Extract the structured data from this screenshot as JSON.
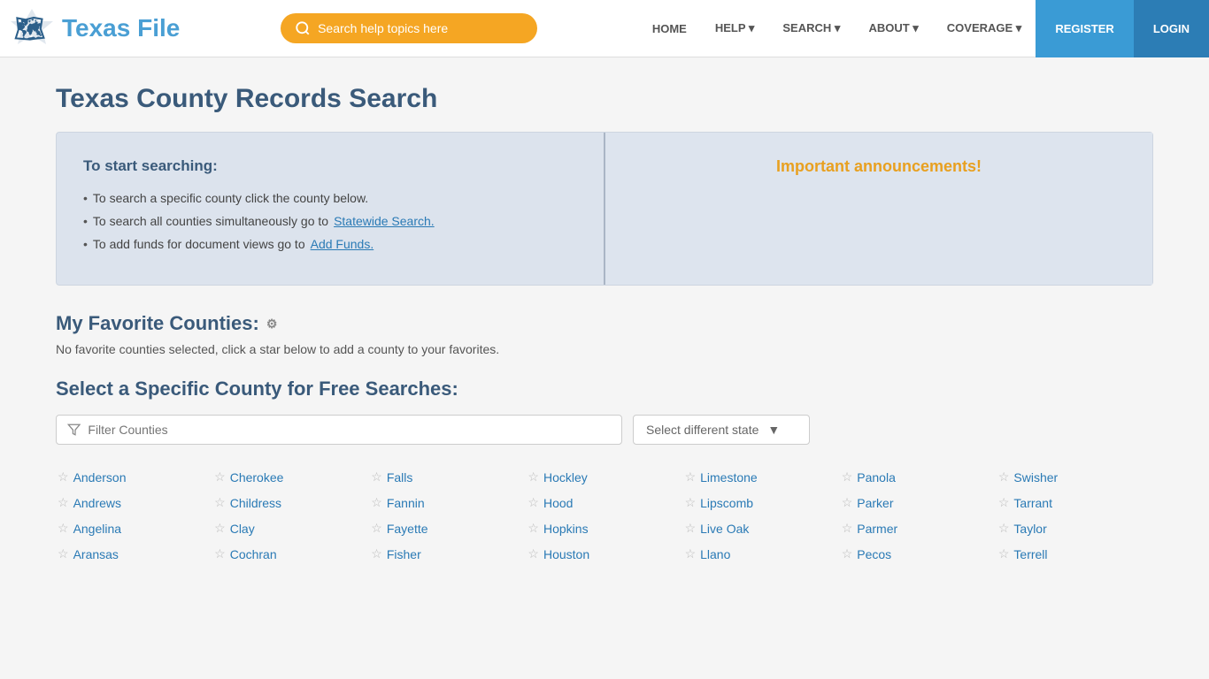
{
  "header": {
    "logo_brand": "Texas",
    "logo_sub": "File",
    "search_placeholder": "Search help topics here",
    "nav_items": [
      {
        "label": "HOME",
        "has_dropdown": false
      },
      {
        "label": "HELP",
        "has_dropdown": true
      },
      {
        "label": "SEARCH",
        "has_dropdown": true
      },
      {
        "label": "ABOUT",
        "has_dropdown": true
      },
      {
        "label": "COVERAGE",
        "has_dropdown": true
      }
    ],
    "register_label": "REGISTER",
    "login_label": "LOGIN"
  },
  "page": {
    "title": "Texas County Records Search",
    "info_left": {
      "heading": "To start searching:",
      "bullets": [
        {
          "text": "To search a specific county click the county below."
        },
        {
          "text_before": "To search all counties simultaneously go to ",
          "link_text": "Statewide Search.",
          "text_after": ""
        },
        {
          "text_before": "To add funds for document views go to ",
          "link_text": "Add Funds.",
          "text_after": ""
        }
      ]
    },
    "info_right": {
      "heading": "Important announcements!"
    },
    "favorites": {
      "heading": "My Favorite Counties:",
      "no_favorites_text": "No favorite counties selected, click a star below to add a county to your favorites."
    },
    "county_section": {
      "heading": "Select a Specific County for Free Searches:",
      "filter_placeholder": "Filter Counties",
      "state_select_label": "Select different state",
      "counties": [
        "Anderson",
        "Andrews",
        "Angelina",
        "Aransas",
        "Cherokee",
        "Childress",
        "Clay",
        "Cochran",
        "Falls",
        "Fannin",
        "Fayette",
        "Fisher",
        "Hockley",
        "Hood",
        "Hopkins",
        "Houston",
        "Limestone",
        "Lipscomb",
        "Live Oak",
        "Llano",
        "Panola",
        "Parker",
        "Parmer",
        "Pecos",
        "Swisher",
        "Tarrant",
        "Taylor",
        "Terrell"
      ]
    }
  }
}
